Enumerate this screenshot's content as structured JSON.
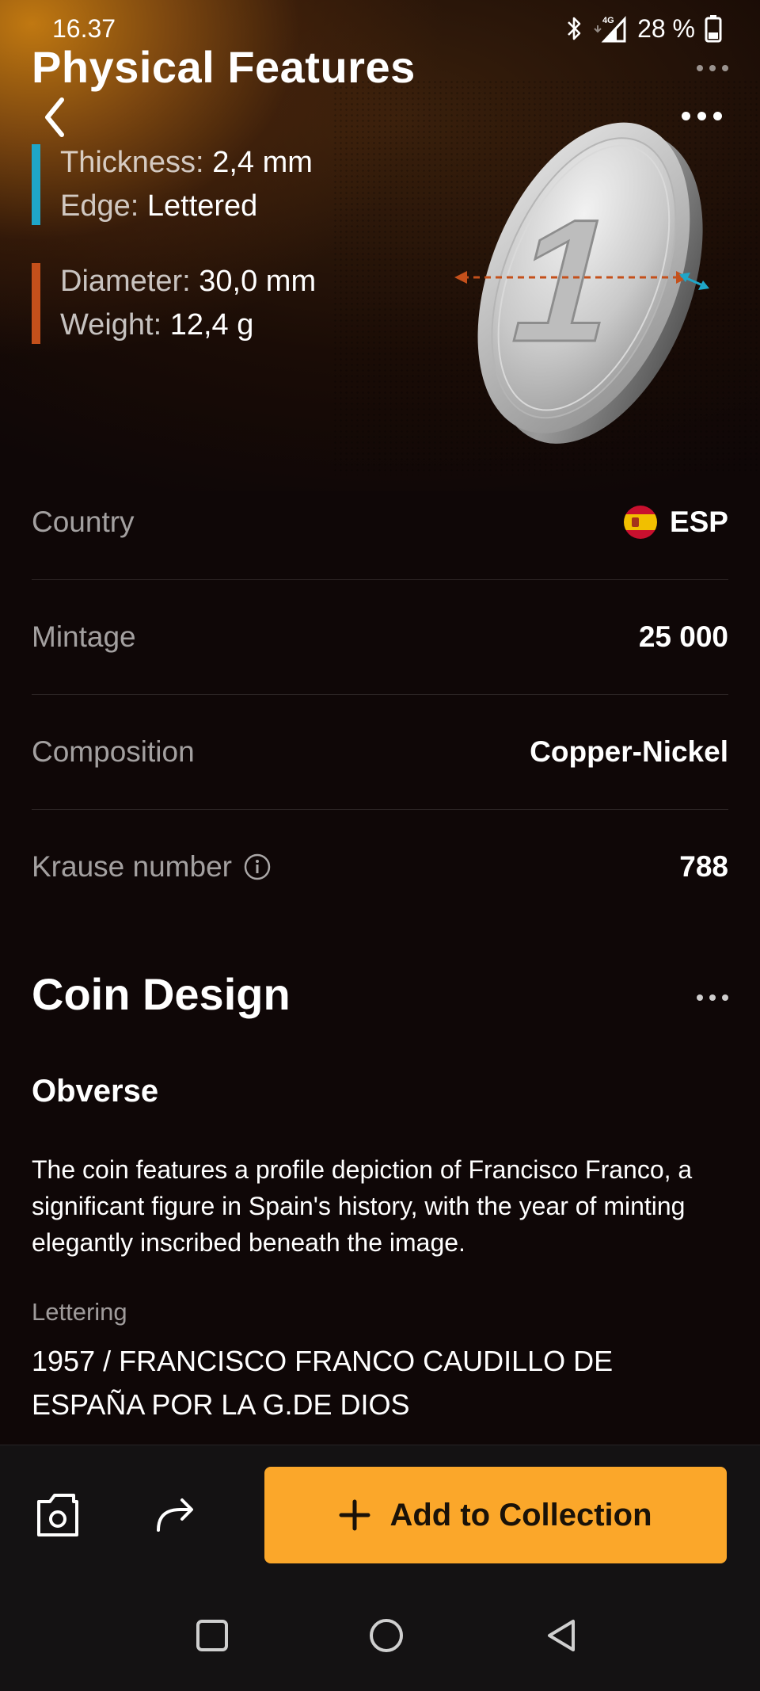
{
  "status_bar": {
    "time": "16.37",
    "battery": "28 %"
  },
  "header": {
    "title": "Physical Features"
  },
  "features": {
    "group1": [
      {
        "label": "Thickness:",
        "value": "2,4 mm"
      },
      {
        "label": "Edge:",
        "value": "Lettered"
      }
    ],
    "group2": [
      {
        "label": "Diameter:",
        "value": "30,0 mm"
      },
      {
        "label": "Weight:",
        "value": "12,4 g"
      }
    ],
    "coin_numeral": "1"
  },
  "details": {
    "country_label": "Country",
    "country_value": "ESP",
    "mintage_label": "Mintage",
    "mintage_value": "25 000",
    "composition_label": "Composition",
    "composition_value": "Copper-Nickel",
    "krause_label": "Krause number",
    "krause_value": "788"
  },
  "design": {
    "title": "Coin Design",
    "obverse_title": "Obverse",
    "obverse_text": "The coin features a profile depiction of Francisco Franco, a significant figure in Spain's history, with the year of minting elegantly inscribed beneath the image.",
    "lettering_label": "Lettering",
    "lettering_text": "1957 / FRANCISCO FRANCO CAUDILLO DE ESPAÑA POR LA G.DE DIOS"
  },
  "actions": {
    "add_label": "Add to Collection"
  },
  "colors": {
    "accent": "#fba72a",
    "thickness_bar": "#1fa6c8",
    "diameter_bar": "#c4501b"
  },
  "icons": [
    "bluetooth-icon",
    "signal-icon",
    "battery-icon",
    "back-icon",
    "more-icon",
    "camera-icon",
    "share-icon",
    "plus-icon",
    "info-icon",
    "nav-recents-icon",
    "nav-home-icon",
    "nav-back-icon"
  ]
}
